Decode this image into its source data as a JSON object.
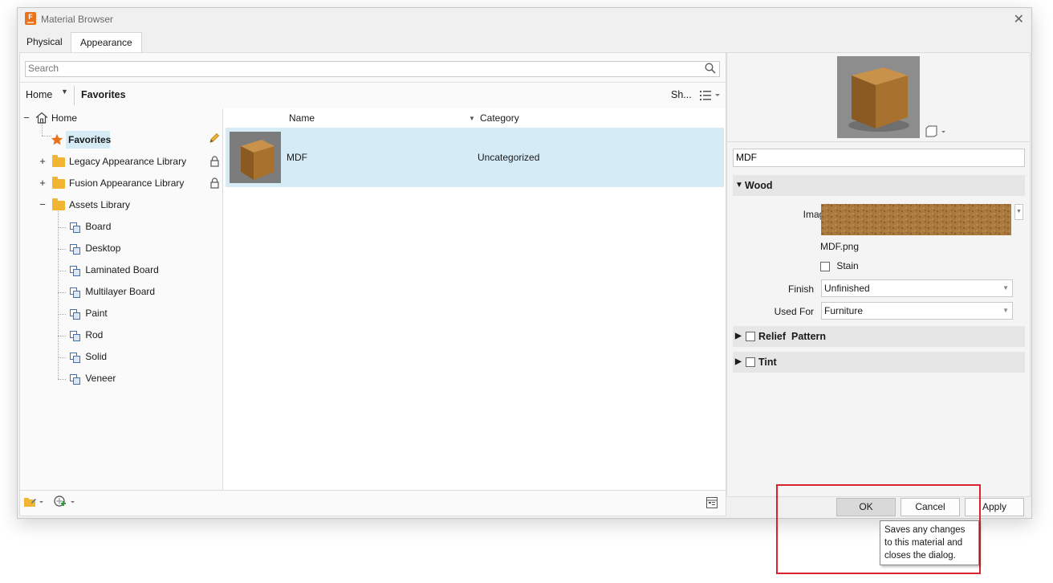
{
  "window": {
    "title": "Material Browser"
  },
  "tabs": [
    {
      "label": "Physical",
      "active": false
    },
    {
      "label": "Appearance",
      "active": true
    }
  ],
  "search": {
    "placeholder": "Search",
    "value": ""
  },
  "breadcrumb": {
    "home": "Home",
    "current": "Favorites",
    "show_label": "Sh..."
  },
  "tree": {
    "home": "Home",
    "favorites": "Favorites",
    "legacy": "Legacy Appearance Library",
    "fusion": "Fusion Appearance Library",
    "assets": "Assets Library",
    "children": [
      "Board",
      "Desktop",
      "Laminated Board",
      "Multilayer Board",
      "Paint",
      "Rod",
      "Solid",
      "Veneer"
    ]
  },
  "list": {
    "columns": {
      "name": "Name",
      "category": "Category"
    },
    "rows": [
      {
        "name": "MDF",
        "category": "Uncategorized"
      }
    ]
  },
  "editor": {
    "material_name": "MDF",
    "sections": {
      "wood": "Wood",
      "relief": "Relief  Pattern",
      "tint": "Tint"
    },
    "image_label": "Image",
    "image_file": "MDF.png",
    "stain_label": "Stain",
    "finish_label": "Finish",
    "finish_value": "Unfinished",
    "used_for_label": "Used For",
    "used_for_value": "Furniture"
  },
  "buttons": {
    "ok": "OK",
    "cancel": "Cancel",
    "apply": "Apply"
  },
  "tooltip": {
    "line1": "Saves any changes",
    "line2": "to this material and",
    "line3": "closes the dialog."
  },
  "colors": {
    "selection": "#d5ecf7",
    "folder": "#f2b533",
    "highlight": "#d9232d",
    "app_icon": "#e8731a"
  }
}
